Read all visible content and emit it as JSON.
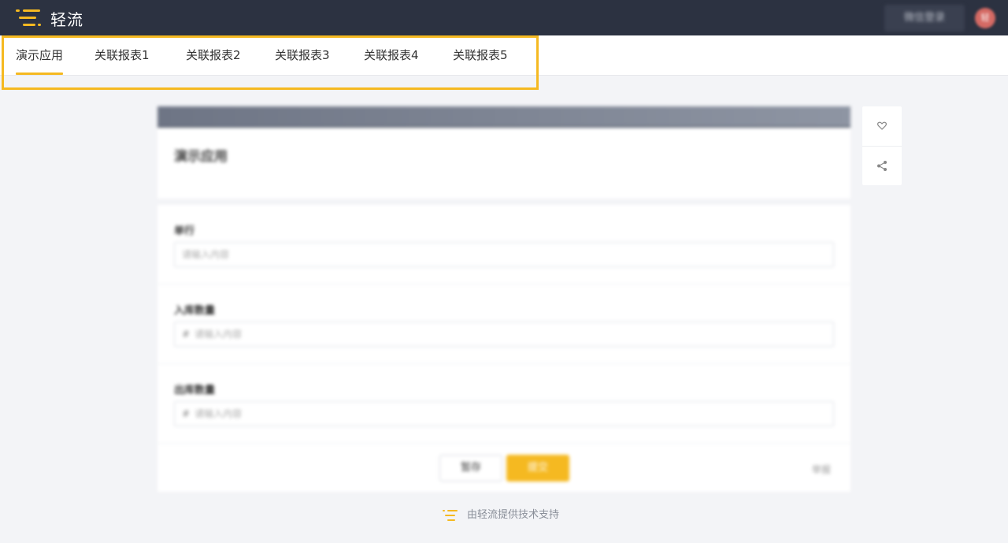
{
  "topbar": {
    "brand": "轻流",
    "action_button": "微信登录",
    "avatar_initials": "轻"
  },
  "tabs": [
    {
      "label": "演示应用",
      "active": true
    },
    {
      "label": "关联报表1",
      "active": false
    },
    {
      "label": "关联报表2",
      "active": false
    },
    {
      "label": "关联报表3",
      "active": false
    },
    {
      "label": "关联报表4",
      "active": false
    },
    {
      "label": "关联报表5",
      "active": false
    }
  ],
  "form": {
    "title": "演示应用",
    "fields": [
      {
        "label": "单行",
        "placeholder": "请输入内容",
        "prefix": ""
      },
      {
        "label": "入库数量",
        "placeholder": "请输入内容",
        "prefix": "#"
      },
      {
        "label": "出库数量",
        "placeholder": "请输入内容",
        "prefix": "#"
      }
    ],
    "save_label": "暂存",
    "submit_label": "提交",
    "report_label": "举报"
  },
  "footer": {
    "text": "由轻流提供技术支持"
  },
  "colors": {
    "accent": "#f5b921",
    "topbar": "#2c3241"
  }
}
